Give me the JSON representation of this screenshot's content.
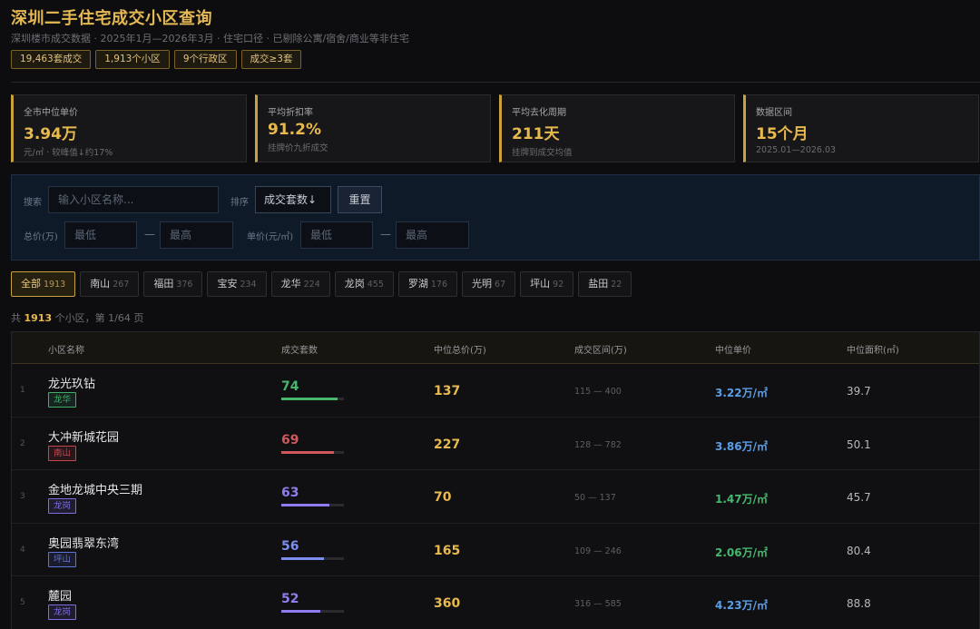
{
  "header": {
    "title": "深圳二手住宅成交小区查询",
    "subtitle": "深圳楼市成交数据 · 2025年1月—2026年3月 · 住宅口径 · 已剔除公寓/宿舍/商业等非住宅",
    "chips": [
      "19,463套成交",
      "1,913个小区",
      "9个行政区",
      "成交≥3套"
    ]
  },
  "stats": [
    {
      "label": "全市中位单价",
      "value": "3.94万",
      "sub": "元/㎡ · 较峰值↓约17%"
    },
    {
      "label": "平均折扣率",
      "value": "91.2%",
      "sub": "挂牌价九折成交"
    },
    {
      "label": "平均去化周期",
      "value": "211天",
      "sub": "挂牌到成交均值"
    },
    {
      "label": "数据区间",
      "value": "15个月",
      "sub": "2025.01—2026.03"
    }
  ],
  "filter": {
    "search_label": "搜索",
    "search_placeholder": "输入小区名称...",
    "sort_label": "排序",
    "sort_value": "成交套数↓",
    "reset_label": "重置",
    "total_label": "总价(万)",
    "unit_label": "单价(元/㎡)",
    "min_placeholder": "最低",
    "max_placeholder": "最高",
    "dash": "—"
  },
  "tabs": [
    {
      "label": "全部",
      "count": "1913",
      "active": true
    },
    {
      "label": "南山",
      "count": "267"
    },
    {
      "label": "福田",
      "count": "376"
    },
    {
      "label": "宝安",
      "count": "234"
    },
    {
      "label": "龙华",
      "count": "224"
    },
    {
      "label": "龙岗",
      "count": "455"
    },
    {
      "label": "罗湖",
      "count": "176"
    },
    {
      "label": "光明",
      "count": "67"
    },
    {
      "label": "坪山",
      "count": "92"
    },
    {
      "label": "盐田",
      "count": "22"
    }
  ],
  "summary": {
    "prefix": "共 ",
    "count": "1913",
    "suffix": " 个小区，第 1/64 页"
  },
  "table": {
    "headers": [
      "小区名称",
      "成交套数",
      "中位总价(万)",
      "成交区间(万)",
      "中位单价",
      "中位面积(㎡)"
    ],
    "rows": [
      {
        "idx": "1",
        "name": "龙光玖钻",
        "district": "龙华",
        "district_color": "#3fae6a",
        "count": "74",
        "count_fraction": 0.9,
        "count_color": "#45b86d",
        "total": "137",
        "range": "115 — 400",
        "unit": "3.22万/㎡",
        "unit_color": "#5a9ee6",
        "area": "39.7"
      },
      {
        "idx": "2",
        "name": "大冲新城花园",
        "district": "南山",
        "district_color": "#c8474f",
        "count": "69",
        "count_fraction": 0.84,
        "count_color": "#d0575c",
        "total": "227",
        "range": "128 — 782",
        "unit": "3.86万/㎡",
        "unit_color": "#5a9ee6",
        "area": "50.1"
      },
      {
        "idx": "3",
        "name": "金地龙城中央三期",
        "district": "龙岗",
        "district_color": "#7d6ee0",
        "count": "63",
        "count_fraction": 0.77,
        "count_color": "#8e7df0",
        "total": "70",
        "range": "50 — 137",
        "unit": "1.47万/㎡",
        "unit_color": "#45b86d",
        "area": "45.7"
      },
      {
        "idx": "4",
        "name": "奥园翡翠东湾",
        "district": "坪山",
        "district_color": "#5f72d8",
        "count": "56",
        "count_fraction": 0.68,
        "count_color": "#7c8ef0",
        "total": "165",
        "range": "109 — 246",
        "unit": "2.06万/㎡",
        "unit_color": "#45b86d",
        "area": "80.4"
      },
      {
        "idx": "5",
        "name": "麓园",
        "district": "龙岗",
        "district_color": "#7d6ee0",
        "count": "52",
        "count_fraction": 0.63,
        "count_color": "#8e7df0",
        "total": "360",
        "range": "316 — 585",
        "unit": "4.23万/㎡",
        "unit_color": "#5a9ee6",
        "area": "88.8"
      }
    ]
  }
}
